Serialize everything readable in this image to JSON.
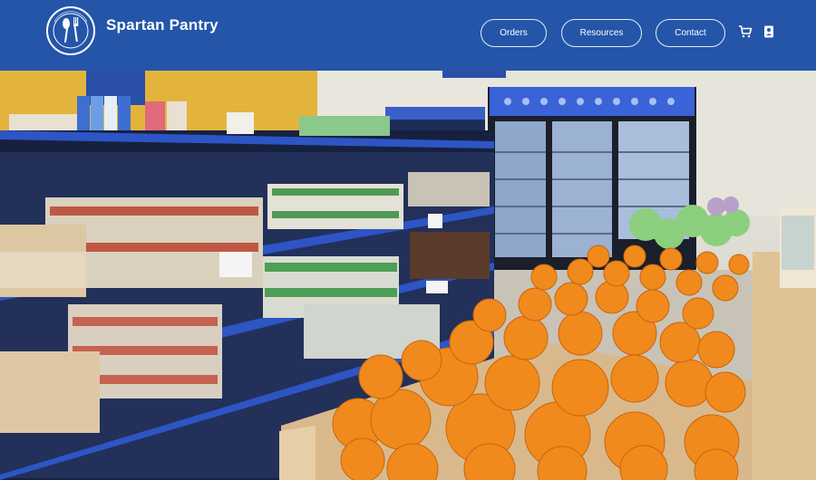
{
  "header": {
    "brand": "Spartan Pantry",
    "logo_text": "SPARTAN FOOD PANTRY",
    "nav": {
      "orders": "Orders",
      "resources": "Resources",
      "contact": "Contact"
    },
    "icons": [
      "cart-icon",
      "account-icon"
    ]
  },
  "hero": {
    "image_subject": "food pantry shelves with canned goods, refrigerators and crates of oranges"
  },
  "colors": {
    "header_bg": "#2455a8",
    "button_border": "#e6ecf7",
    "text": "#ffffff"
  }
}
